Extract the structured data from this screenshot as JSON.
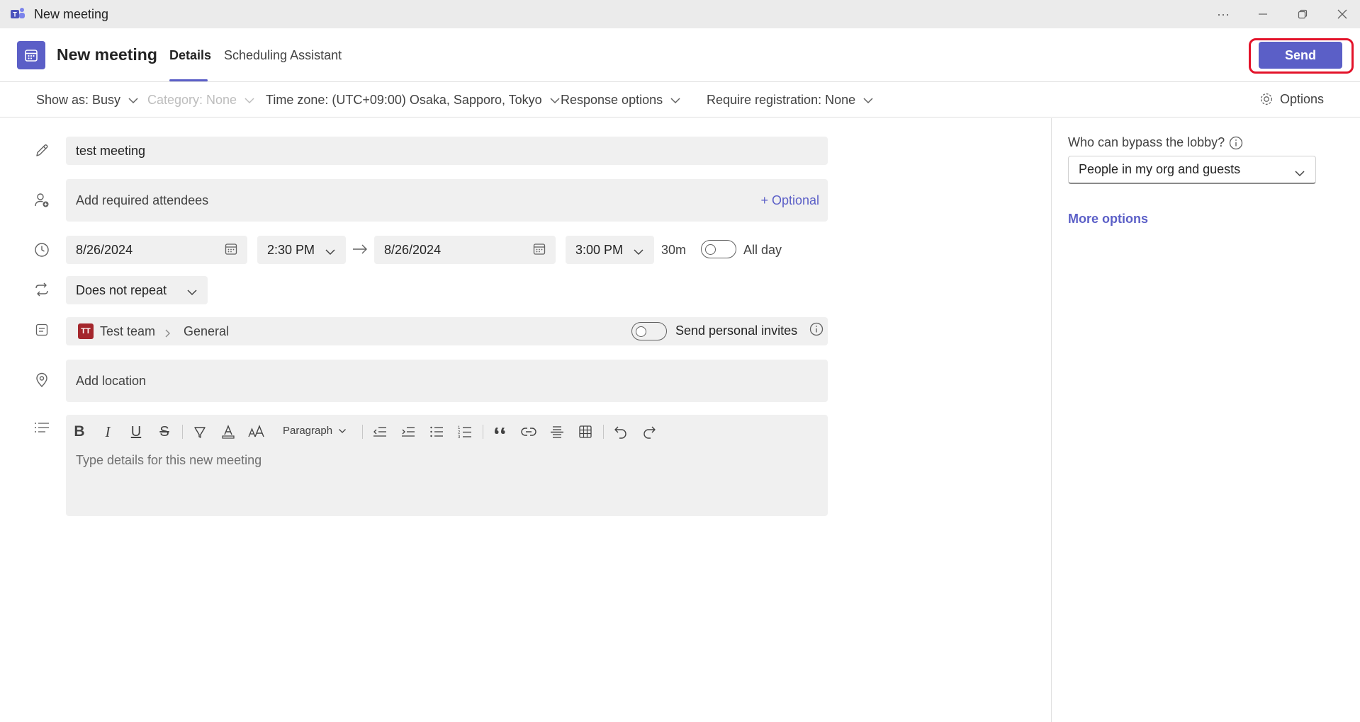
{
  "window": {
    "title": "New meeting",
    "controls": {
      "more": "···"
    }
  },
  "header": {
    "title": "New meeting",
    "tabs": [
      {
        "label": "Details",
        "active": true
      },
      {
        "label": "Scheduling Assistant",
        "active": false
      }
    ],
    "send_label": "Send"
  },
  "options_bar": {
    "show_as": "Show as: Busy",
    "category": "Category: None",
    "time_zone": "Time zone: (UTC+09:00) Osaka, Sapporo, Tokyo",
    "response_options": "Response options",
    "require_registration": "Require registration: None",
    "options_label": "Options"
  },
  "form": {
    "title_value": "test meeting",
    "attendees_placeholder": "Add required attendees",
    "optional_link": "+ Optional",
    "start_date": "8/26/2024",
    "start_time": "2:30 PM",
    "end_date": "8/26/2024",
    "end_time": "3:00 PM",
    "duration": "30m",
    "all_day_label": "All day",
    "all_day_on": false,
    "repeat": "Does not repeat",
    "channel": {
      "team_initials": "TT",
      "team_name": "Test team",
      "channel_name": "General"
    },
    "personal_invites_label": "Send personal invites",
    "personal_invites_on": false,
    "location_placeholder": "Add location",
    "editor": {
      "paragraph_label": "Paragraph",
      "placeholder": "Type details for this new meeting"
    }
  },
  "side_panel": {
    "lobby_label": "Who can bypass the lobby?",
    "lobby_value": "People in my org and guests",
    "more_options": "More options"
  },
  "colors": {
    "brand": "#5b5fc7",
    "highlight": "#e3132a",
    "team_badge": "#a4262c"
  }
}
